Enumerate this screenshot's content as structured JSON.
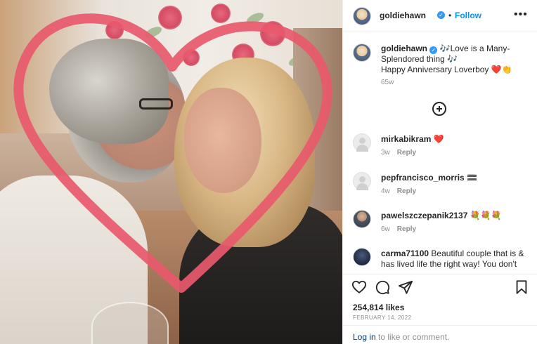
{
  "post": {
    "username": "goldiehawn",
    "verified": true,
    "dot": "•",
    "follow_label": "Follow",
    "more_icon": "more-options-icon"
  },
  "caption": {
    "username": "goldiehawn",
    "line1": "🎶Love is a Many-Splendored thing 🎶",
    "line2": "Happy Anniversary Loverboy ❤️👏",
    "time": "65w"
  },
  "comments": [
    {
      "username": "mirkabikram",
      "text": "❤️",
      "time": "3w",
      "reply_label": "Reply"
    },
    {
      "username": "pepfrancisco_morris",
      "text": "🟰",
      "time": "4w",
      "reply_label": "Reply"
    },
    {
      "username": "pawelszczepanik2137",
      "text": "💐💐💐",
      "time": "6w",
      "reply_label": "Reply"
    },
    {
      "username": "carma71100",
      "text": "Beautiful couple that is & has lived life the right way! You don't"
    }
  ],
  "actions": {
    "likes": "254,814 likes",
    "date": "FEBRUARY 14, 2022",
    "login_link": "Log in",
    "login_rest": " to like or comment."
  },
  "colors": {
    "accent": "#0095f6",
    "heart": "#e8596d",
    "muted": "#8e8e8e",
    "verified": "#3897f0"
  }
}
